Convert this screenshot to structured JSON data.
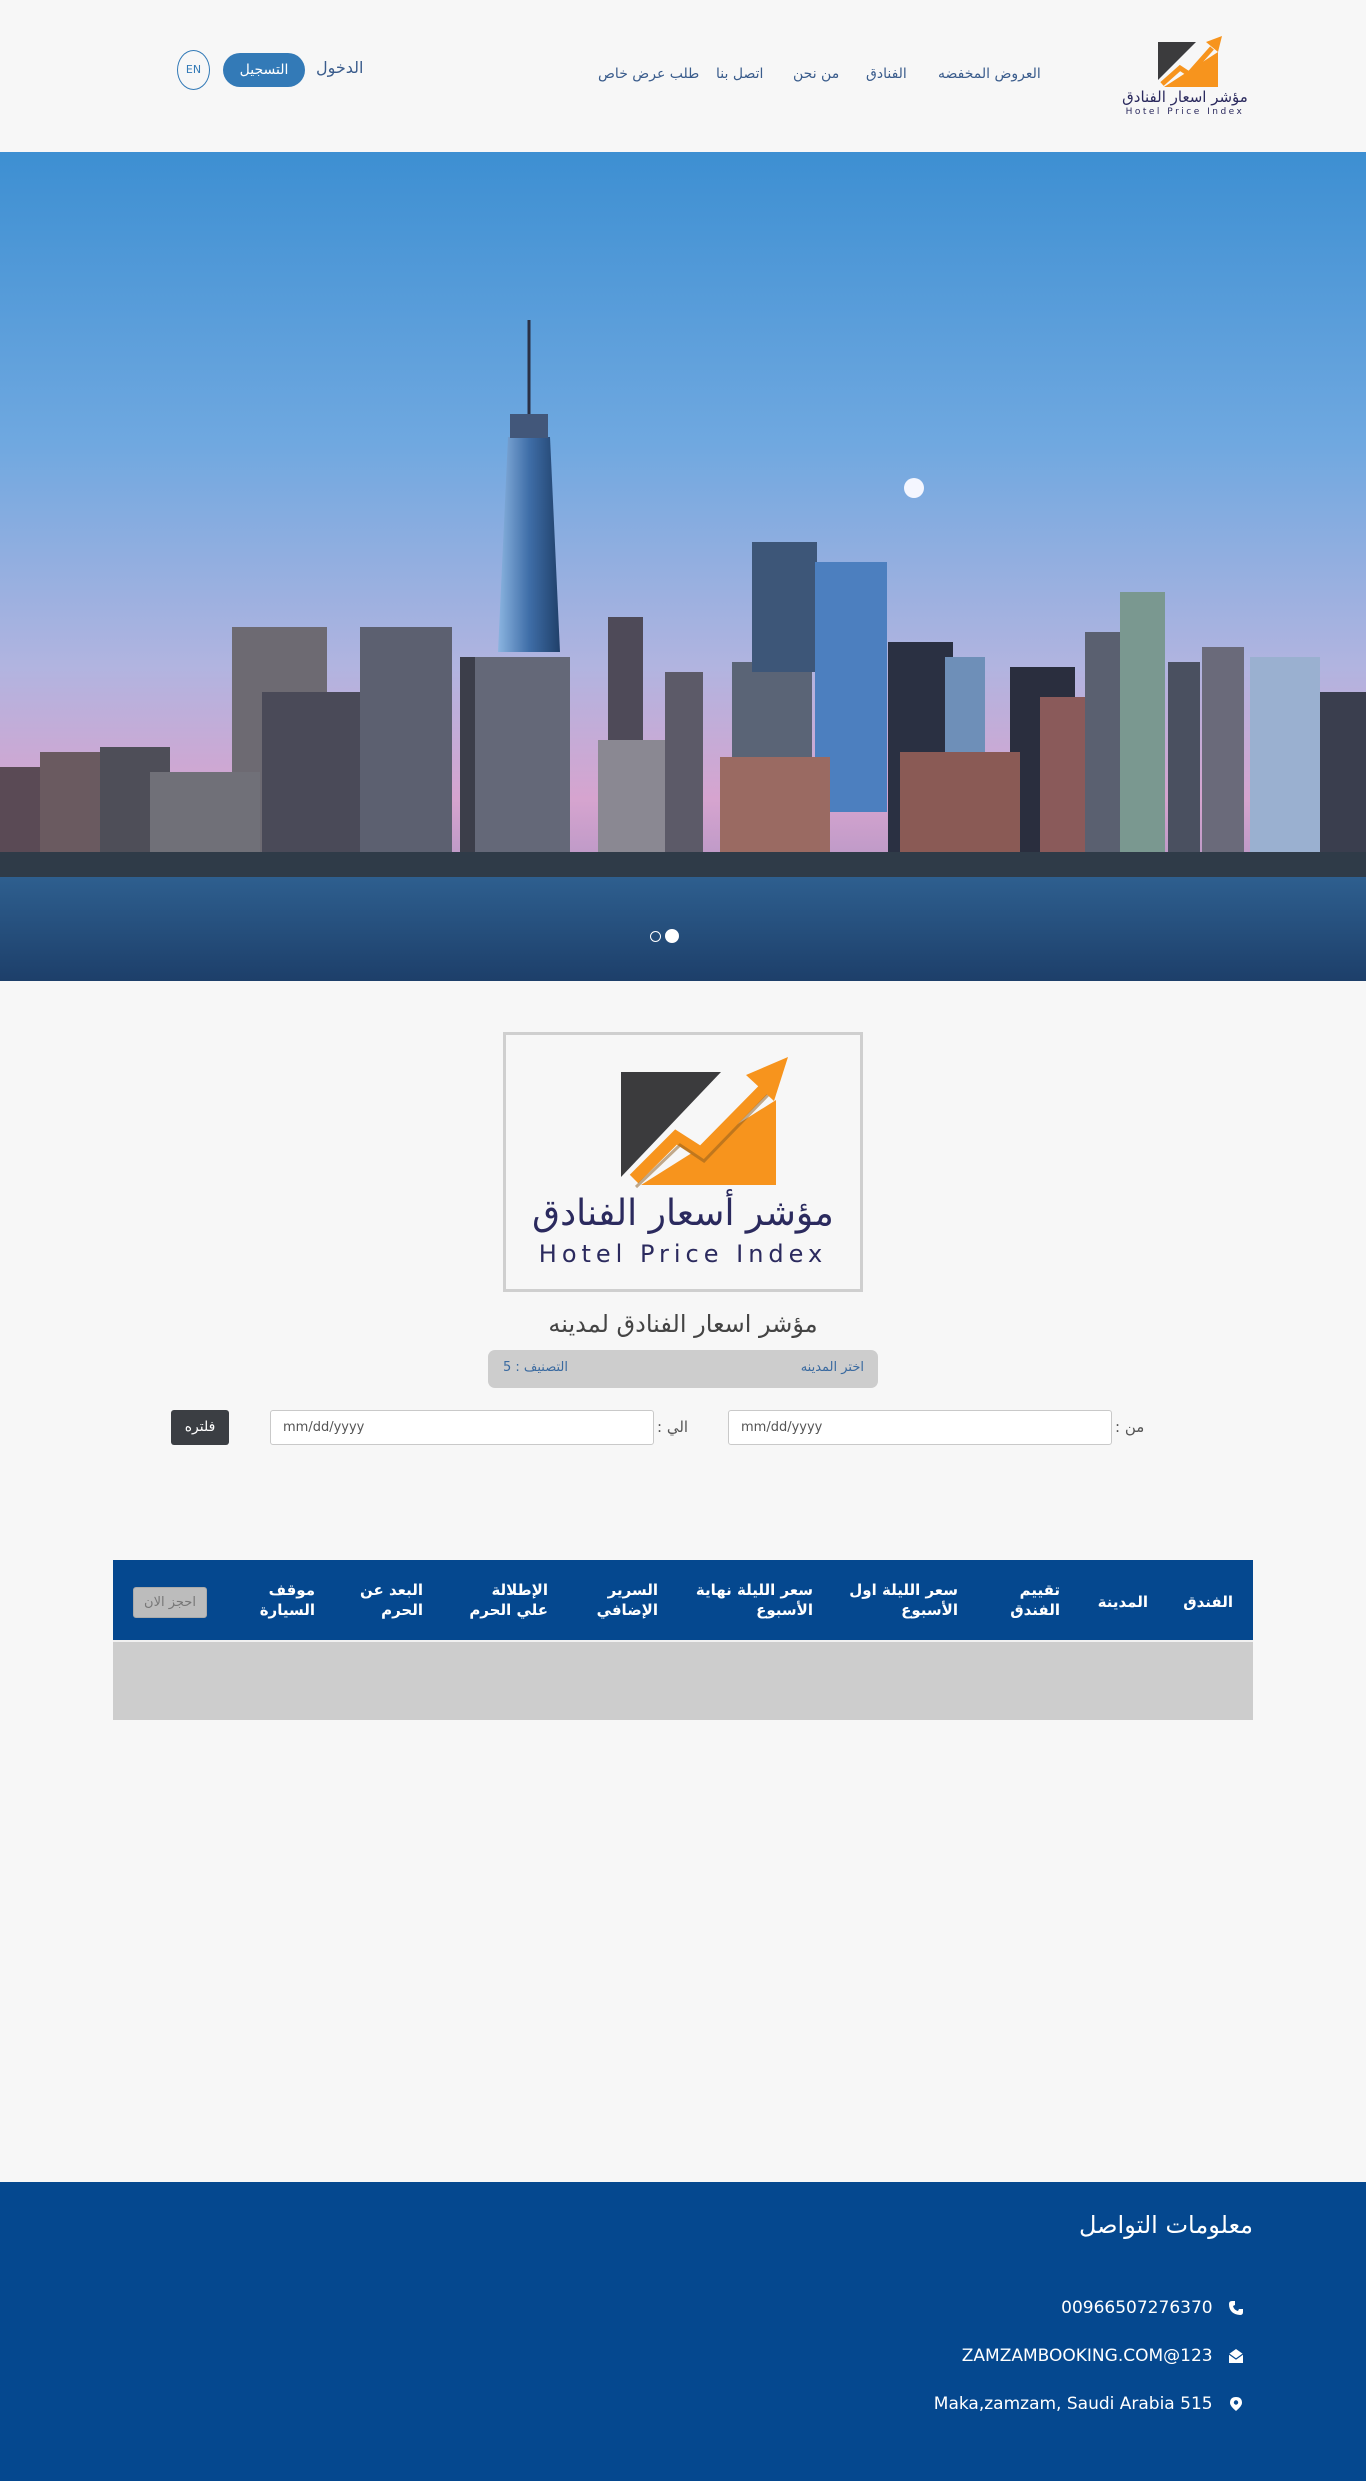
{
  "brand": {
    "name_ar": "مؤشر اسعار الفنادق",
    "name_ar_large": "مؤشر أسعار الفنادق",
    "name_en": "Hotel Price Index",
    "colors": {
      "orange": "#f7941d",
      "dark": "#3b3b3d",
      "navy": "#2b2a5e"
    }
  },
  "nav": {
    "offers": "العروض المخفضه",
    "hotels": "الفنادق",
    "about": "من نحن",
    "contact": "اتصل بنا",
    "special": "طلب عرض خاص"
  },
  "auth": {
    "login": "الدخول",
    "register": "التسجيل",
    "lang": "EN"
  },
  "hero": {
    "slides": 2,
    "active_slide": 2
  },
  "search": {
    "title": "مؤشر اسعار الفنادق لمدينه",
    "city_select": "اختر المدينه",
    "rating_label": "التصنيف : 5",
    "from_label": "من :",
    "to_label": "الي :",
    "date_placeholder_from": "mm/dd/yyyy",
    "date_placeholder_to": "mm/dd/yyyy",
    "filter_button": "فلتره"
  },
  "table": {
    "headers": {
      "hotel": "الفندق",
      "city": "المدينة",
      "rating": "تقييم الفندق",
      "first_night": "سعر الليلة اول الأسبوع",
      "weekend_night": "سعر الليلة نهاية الأسبوع",
      "extra_bed": "السرير الإضافي",
      "haram_view": "الإطلالة علي الحرم",
      "haram_distance": "البعد عن الحرم",
      "parking": "موقف السيارة"
    },
    "book_button": "احجز الان",
    "rows": []
  },
  "footer": {
    "title": "معلومات التواصل",
    "phone": "00966507276370",
    "email": "ZAMZAMBOOKING.COM@123",
    "address": "Maka,zamzam, Saudi Arabia 515"
  },
  "colors": {
    "primary": "#05488f",
    "link": "#3a5c8c",
    "button_blue": "#337ab7",
    "dark_button": "#3b3e43"
  }
}
